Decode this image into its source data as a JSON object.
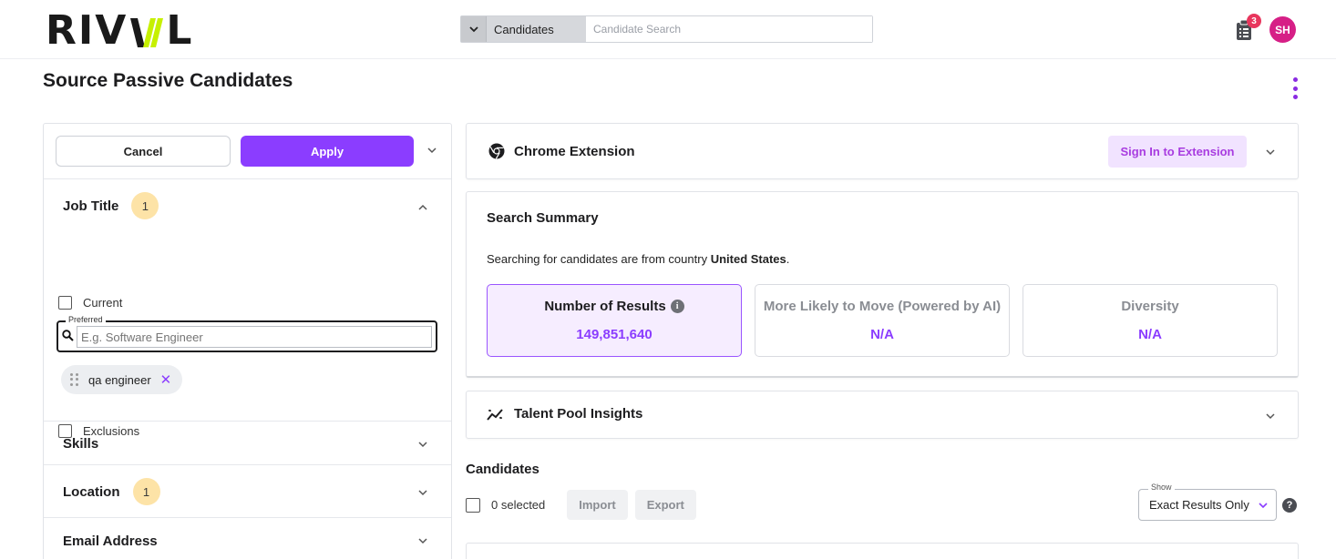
{
  "brand": {
    "logo_text_left": "RIV",
    "logo_text_right": "L",
    "accent": "#c6f000"
  },
  "header": {
    "search_scope": "Candidates",
    "search_placeholder": "Candidate Search",
    "notification_count": "3",
    "avatar_initials": "SH",
    "icons": [
      "chevron-down-icon",
      "clipboard-list-icon"
    ]
  },
  "page": {
    "title": "Source Passive Candidates"
  },
  "filters": {
    "cancel_label": "Cancel",
    "apply_label": "Apply",
    "job_title": {
      "label": "Job Title",
      "count": "1",
      "current_label": "Current",
      "preferred_legend": "Preferred",
      "preferred_placeholder": "E.g. Software Engineer",
      "chips": [
        "qa engineer"
      ],
      "exclusions_label": "Exclusions"
    },
    "skills": {
      "label": "Skills"
    },
    "location": {
      "label": "Location",
      "count": "1"
    },
    "email": {
      "label": "Email Address"
    }
  },
  "chrome_extension": {
    "title": "Chrome Extension",
    "sign_in_label": "Sign In to Extension"
  },
  "search_summary": {
    "title": "Search Summary",
    "text_prefix": "Searching for candidates are from country ",
    "country": "United States",
    "text_suffix": ".",
    "stats": [
      {
        "label": "Number of Results",
        "value": "149,851,640"
      },
      {
        "label": "More Likely to Move (Powered by AI)",
        "value": "N/A"
      },
      {
        "label": "Diversity",
        "value": "N/A"
      }
    ]
  },
  "talent_pool": {
    "title": "Talent Pool Insights"
  },
  "candidates": {
    "title": "Candidates",
    "selected_text": "0 selected",
    "import_label": "Import",
    "export_label": "Export",
    "show_legend": "Show",
    "show_value": "Exact Results Only",
    "help_glyph": "?"
  },
  "colors": {
    "primary": "#8b3dff",
    "badge": "#e8365d",
    "avatar": "#d61f86",
    "pill": "#fde3a7"
  }
}
